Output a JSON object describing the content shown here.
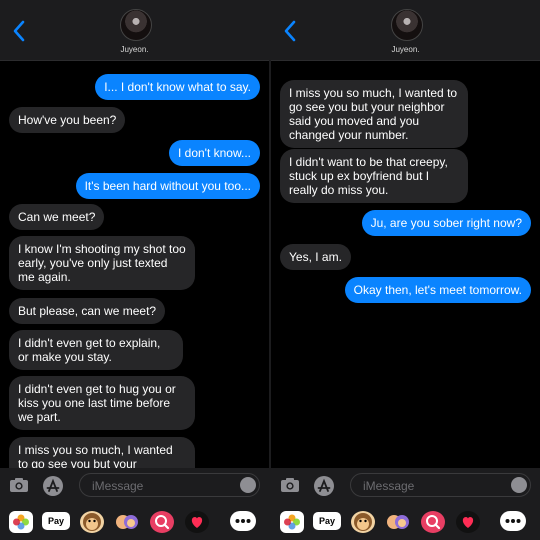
{
  "contact": {
    "name": "Juyeon."
  },
  "input": {
    "placeholder": "iMessage"
  },
  "apps": {
    "pay_label": "Pay"
  },
  "left_thread": [
    {
      "dir": "out",
      "text": "I... I don't know what to say."
    },
    {
      "dir": "in",
      "text": "How've you been?"
    },
    {
      "dir": "out",
      "text": "I don't know..."
    },
    {
      "dir": "out",
      "text": "It's been hard without you too..."
    },
    {
      "dir": "in",
      "text": "Can we meet?"
    },
    {
      "dir": "in",
      "text": "I know I'm shooting my shot too early, you've only just texted me again."
    },
    {
      "dir": "in",
      "text": "But please, can we meet?"
    },
    {
      "dir": "in",
      "text": "I didn't even get to explain, or make you stay."
    },
    {
      "dir": "in",
      "text": "I didn't even get to hug you or kiss you one last time before we part."
    },
    {
      "dir": "in",
      "text": "I miss you so much, I wanted to go see you but your neighbor"
    }
  ],
  "right_thread": [
    {
      "dir": "in",
      "text": "I miss you so much, I wanted to go see you but your neighbor said you moved and you changed your number."
    },
    {
      "dir": "in",
      "text": "I didn't want to be that creepy, stuck up ex boyfriend but I really do miss you."
    },
    {
      "dir": "out",
      "text": "Ju, are you sober right now?"
    },
    {
      "dir": "in",
      "text": "Yes, I am."
    },
    {
      "dir": "out",
      "text": "Okay then, let's meet tomorrow."
    }
  ]
}
